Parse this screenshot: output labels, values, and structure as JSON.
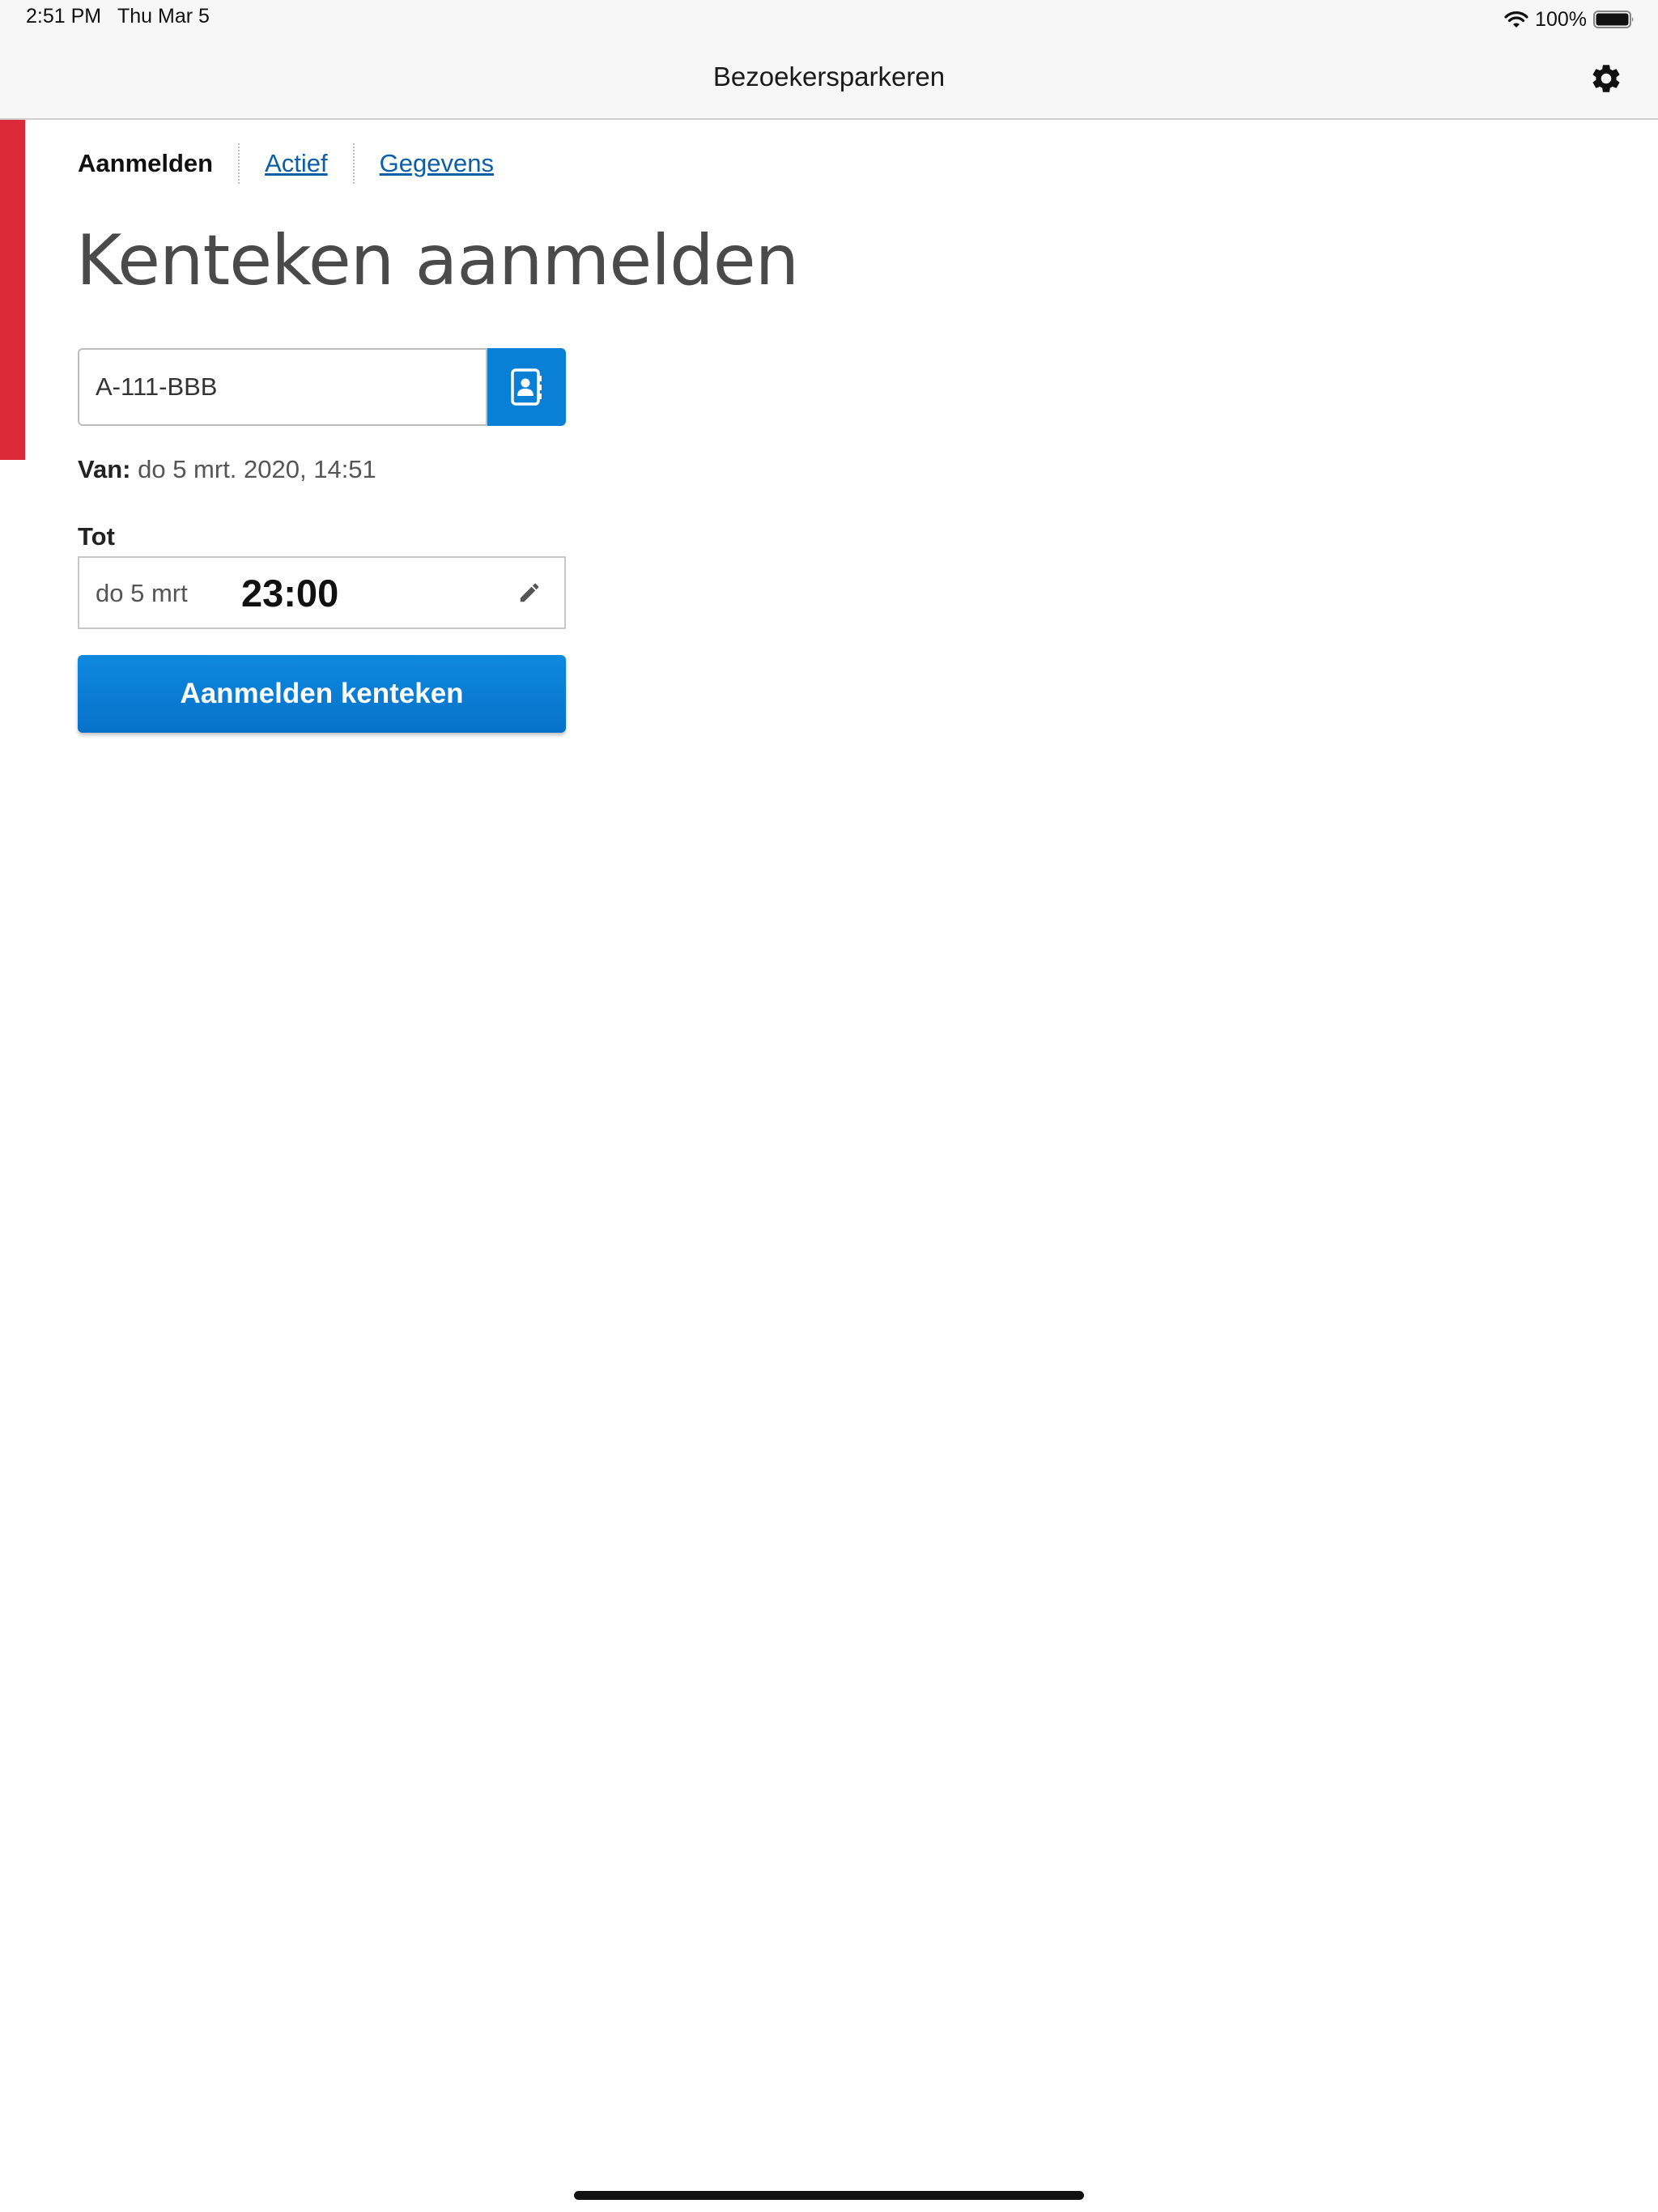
{
  "status_bar": {
    "time": "2:51 PM",
    "date": "Thu Mar 5",
    "battery_percent": "100%",
    "battery_level": 1.0,
    "icons": [
      "wifi-icon",
      "battery-icon"
    ]
  },
  "nav": {
    "title": "Bezoekersparkeren",
    "settings_icon": "gear-icon"
  },
  "tabs": [
    {
      "label": "Aanmelden",
      "active": true
    },
    {
      "label": "Actief",
      "active": false
    },
    {
      "label": "Gegevens",
      "active": false
    }
  ],
  "page_title": "Kenteken aanmelden",
  "plate": {
    "value": "A-111-BBB",
    "contacts_icon": "contacts-icon"
  },
  "van": {
    "label": "Van:",
    "value": "do 5 mrt. 2020, 14:51"
  },
  "tot": {
    "label": "Tot",
    "date": "do 5 mrt",
    "time": "23:00",
    "edit_icon": "pencil-icon"
  },
  "submit_label": "Aanmelden kenteken",
  "colors": {
    "accent_red": "#dc2a3b",
    "primary_blue": "#0a7fd6",
    "link_blue": "#0b5fa8"
  }
}
